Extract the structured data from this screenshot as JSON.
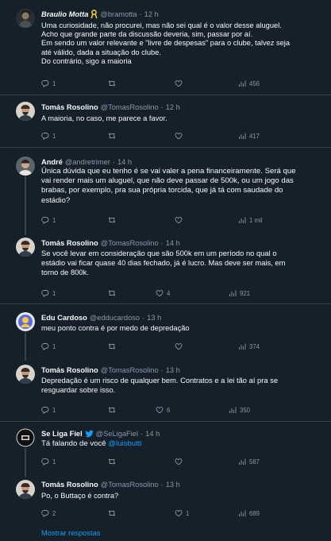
{
  "tweets": [
    {
      "name": "Braulio Motta",
      "badge_icon": "ribbon-icon",
      "handle": "@bramotta",
      "dot": "·",
      "time": "12 h",
      "lines": [
        "Uma curiosidade, não procurei, mas não sei qual é o valor desse aluguel.",
        "Acho que grande parte da discussão deveria, sim, passar por aí.",
        "Em sendo um valor relevante e \"livre de despesas\" para o clube, talvez seja",
        "até válido, dada a situação do clube.",
        "Do contrário, sigo a maioria"
      ],
      "replies": "1",
      "retweets": "",
      "likes": "",
      "views": "456"
    },
    {
      "name": "Tomás Rosolino",
      "handle": "@TomasRosolino",
      "dot": "·",
      "time": "12 h",
      "lines": [
        "A maioria, no caso, me parece a favor."
      ],
      "replies": "1",
      "retweets": "",
      "likes": "",
      "views": "417"
    },
    {
      "name": "André",
      "handle": "@andretrimer",
      "dot": "·",
      "time": "14 h",
      "lines": [
        "Única dúvida que eu tenho é se vai valer a pena financeiramente. Será que",
        "vai render mais um aluguel, que não deve passar de 500k, ou um jogo das",
        "brabas, por exemplo, pra sua própria torcida, que já tá com saudade do",
        "estádio?"
      ],
      "replies": "1",
      "retweets": "",
      "likes": "",
      "views": "1 mil"
    },
    {
      "name": "Tomás Rosolino",
      "handle": "@TomasRosolino",
      "dot": "·",
      "time": "14 h",
      "lines": [
        "Se você levar em consideração que são 500k em um período no qual o",
        "estádio vai ficar quase 40 dias fechado, já é lucro. Mas deve ser mais, em",
        "torno de 800k."
      ],
      "replies": "1",
      "retweets": "",
      "likes": "4",
      "views": "921"
    },
    {
      "name": "Edu Cardoso",
      "handle": "@edducardoso",
      "dot": "·",
      "time": "13 h",
      "lines": [
        "meu ponto contra é por medo de depredação"
      ],
      "replies": "1",
      "retweets": "",
      "likes": "",
      "views": "374"
    },
    {
      "name": "Tomás Rosolino",
      "handle": "@TomasRosolino",
      "dot": "·",
      "time": "13 h",
      "lines": [
        "Depredação é um risco de qualquer bem. Contratos e a lei tão aí pra se",
        "resguardar sobre isso."
      ],
      "replies": "1",
      "retweets": "",
      "likes": "6",
      "views": "350"
    },
    {
      "name": "Se Liga Fiel",
      "badge_icon": "twitter-bird-icon",
      "handle": "@SeLigaFiel",
      "dot": "·",
      "time": "14 h",
      "text_before": "Tá falando de você ",
      "mention": "@luisbutti",
      "replies": "1",
      "retweets": "",
      "likes": "",
      "views": "587"
    },
    {
      "name": "Tomás Rosolino",
      "handle": "@TomasRosolino",
      "dot": "·",
      "time": "13 h",
      "lines": [
        "Po, o Buttaço é contra?"
      ],
      "replies": "2",
      "retweets": "",
      "likes": "1",
      "views": "689"
    }
  ],
  "show_more": "Mostrar respostas",
  "icons": {
    "reply": "reply-icon",
    "retweet": "retweet-icon",
    "like": "heart-icon",
    "views": "views-icon"
  },
  "colors": {
    "background": "#15202b",
    "text": "#f7f9f9",
    "secondary": "#8b98a5",
    "accent": "#1d9bf0",
    "divider": "#38444d",
    "badge_ribbon": "#f5c542"
  }
}
